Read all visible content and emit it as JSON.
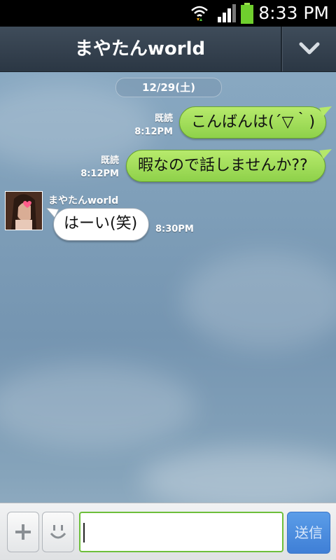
{
  "status_bar": {
    "time": "8:33 PM"
  },
  "header": {
    "title": "まやたんworld"
  },
  "date_divider": "12/29(土)",
  "messages": [
    {
      "text": "こんばんは(´▽｀)",
      "read": "既読",
      "time": "8:12PM"
    },
    {
      "text": "暇なので話しませんか??",
      "read": "既読",
      "time": "8:12PM"
    },
    {
      "sender": "まやたんworld",
      "text": "はーい(笑)",
      "time": "8:30PM"
    }
  ],
  "input_bar": {
    "send_label": "送信",
    "input_value": ""
  },
  "colors": {
    "header": "#2f3b48",
    "outgoing_bubble": "#9ed95a",
    "send_button": "#4a8be0",
    "input_border": "#6dbf3b"
  },
  "icons": {
    "wifi": "wifi-icon",
    "signal": "signal-icon",
    "battery": "battery-icon",
    "dropdown": "chevron-down-icon",
    "add": "plus-icon",
    "sticker": "smiley-icon"
  }
}
